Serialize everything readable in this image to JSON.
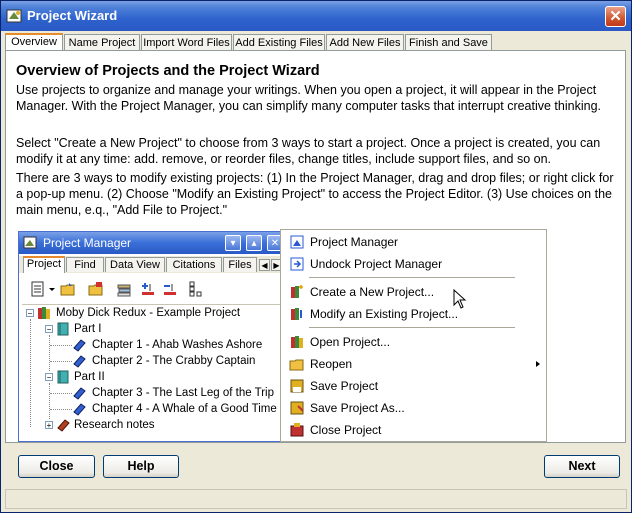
{
  "window": {
    "title": "Project Wizard",
    "close_glyph": "✕"
  },
  "tabs": [
    "Overview",
    "Name Project",
    "Import Word Files",
    "Add Existing Files",
    "Add New Files",
    "Finish and Save"
  ],
  "overview": {
    "heading": "Overview of Projects and the Project Wizard",
    "para1": "Use projects to organize and manage your writings.  When you open a project, it will appear in the Project Manager.  With the Project Manager, you can simplify many computer tasks that interrupt creative thinking.",
    "para2": "Select \"Create a New Project\" to choose from 3 ways to start a project.  Once a project is created, you can modify it at any time:  add. remove, or reorder files, change titles, include support files, and so on.",
    "para3": "There are 3 ways to modify existing projects:  (1) In the Project Manager, drag and drop files; or right click for a pop-up menu.  (2) Choose \"Modify an Existing Project\" to access the Project Editor.  (3) Use choices on the main menu, e.q., \"Add File to Project.\""
  },
  "project_manager": {
    "title": "Project Manager",
    "tabs": [
      "Project",
      "Find",
      "Data View",
      "Citations",
      "Files"
    ],
    "tree": {
      "root": "Moby Dick Redux - Example Project",
      "part1": "Part I",
      "ch1": "Chapter 1 - Ahab Washes Ashore",
      "ch2": "Chapter 2 - The Crabby Captain",
      "part2": "Part II",
      "ch3": "Chapter 3 - The Last Leg of the Trip",
      "ch4": "Chapter 4 - A Whale of a Good Time",
      "research": "Research notes"
    }
  },
  "menu": {
    "items": [
      {
        "label": "Project Manager",
        "icon": "project-manager-icon"
      },
      {
        "label": "Undock Project Manager",
        "icon": "undock-icon"
      },
      {
        "label": "Create a New Project...",
        "icon": "new-project-icon"
      },
      {
        "label": "Modify an Existing Project...",
        "icon": "modify-project-icon"
      },
      {
        "label": "Open Project...",
        "icon": "open-project-icon"
      },
      {
        "label": "Reopen",
        "icon": "reopen-icon"
      },
      {
        "label": "Save Project",
        "icon": "save-project-icon"
      },
      {
        "label": "Save Project As...",
        "icon": "save-as-icon"
      },
      {
        "label": "Close Project",
        "icon": "close-project-icon"
      }
    ]
  },
  "buttons": {
    "close": "Close",
    "help": "Help",
    "next": "Next"
  },
  "colors": {
    "title_blue": "#2a59c4",
    "tab_accent": "#e68b2c",
    "dialog_bg": "#ece9d8"
  }
}
